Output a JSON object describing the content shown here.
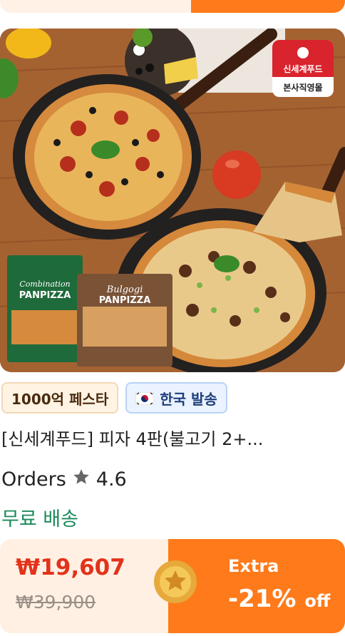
{
  "product": {
    "image_alt": "",
    "brand_badge_top": "신세계푸드",
    "brand_badge_bottom": "본사직영몰",
    "box1_title": "Combination PANPIZZA",
    "box2_title": "Bulgogi PANPIZZA"
  },
  "tags": {
    "festa": "1000억 페스타",
    "shipping": "한국 발송"
  },
  "title": "[신세계푸드] 피자 4판(불고기 2+...",
  "rating": {
    "prefix": "Orders",
    "value": "4.6"
  },
  "free_shipping": "무료 배송",
  "price": {
    "current": "₩19,607",
    "original": "₩39,900",
    "extra_label": "Extra",
    "discount": "-21%",
    "discount_suffix": "off"
  },
  "colors": {
    "accent": "#ff7a1a",
    "price_red": "#e3321a",
    "green": "#1a8a5a"
  }
}
